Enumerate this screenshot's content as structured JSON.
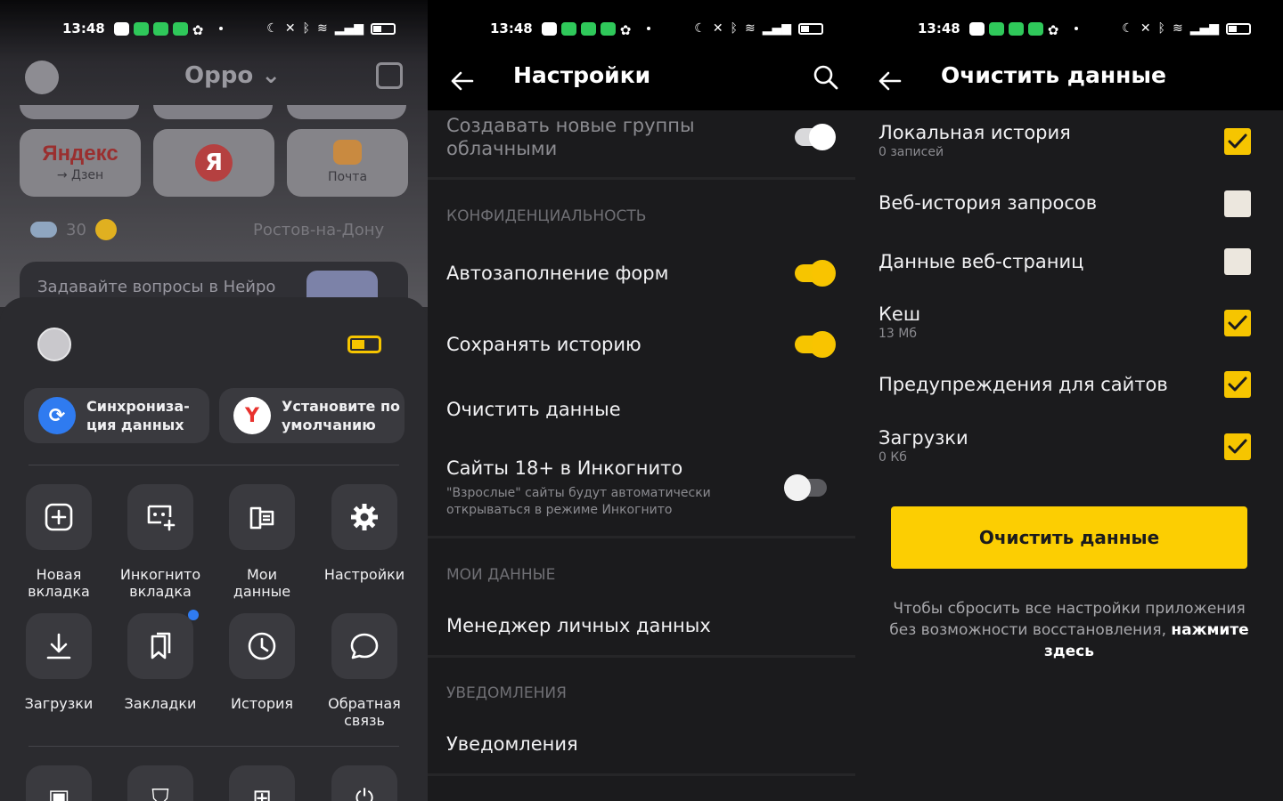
{
  "status": {
    "time": "13:48"
  },
  "panel1": {
    "header_title": "Oppo",
    "tiles": [
      {
        "title": "Яндекс",
        "subtitle": "→ Дзен"
      },
      {
        "title": "Я",
        "subtitle": ""
      },
      {
        "title": "",
        "subtitle": "Почта"
      }
    ],
    "weather": {
      "temp": "30",
      "city": "Ростов-на-Дону"
    },
    "neuro_prompt": "Задавайте вопросы в Нейро",
    "cards": [
      {
        "label": "Синхрониза-\nция данных"
      },
      {
        "label": "Установите по\nумолчанию"
      }
    ],
    "grid": [
      {
        "label": "Новая\nвкладка",
        "icon": "new-tab-icon"
      },
      {
        "label": "Инкогнито\nвкладка",
        "icon": "incognito-icon"
      },
      {
        "label": "Мои\nданные",
        "icon": "my-data-icon"
      },
      {
        "label": "Настройки",
        "icon": "gear-icon"
      },
      {
        "label": "Загрузки",
        "icon": "download-icon"
      },
      {
        "label": "Закладки",
        "icon": "bookmarks-icon"
      },
      {
        "label": "История",
        "icon": "clock-icon"
      },
      {
        "label": "Обратная\nсвязь",
        "icon": "chat-bubble-icon"
      }
    ],
    "accent": "#f6c500"
  },
  "panel2": {
    "title": "Настройки",
    "cloud_groups": "Создавать новые группы\nоблачными",
    "section_privacy": "КОНФИДЕНЦИАЛЬНОСТЬ",
    "autofill": "Автозаполнение форм",
    "save_history": "Сохранять историю",
    "clear_data": "Очистить данные",
    "incognito_18": "Сайты 18+ в Инкогнито",
    "incognito_18_desc": "\"Взрослые\" сайты будут автоматически\nоткрываться в режиме Инкогнито",
    "section_my_data": "МОИ ДАННЫЕ",
    "personal_data_manager": "Менеджер личных данных",
    "section_notifications": "УВЕДОМЛЕНИЯ",
    "notifications": "Уведомления"
  },
  "panel3": {
    "title": "Очистить данные",
    "items": [
      {
        "label": "Локальная история",
        "sub": "0 записей",
        "checked": true
      },
      {
        "label": "Веб-история запросов",
        "sub": "",
        "checked": false
      },
      {
        "label": "Данные веб-страниц",
        "sub": "",
        "checked": false
      },
      {
        "label": "Кеш",
        "sub": "13 Мб",
        "checked": true
      },
      {
        "label": "Предупреждения для сайтов",
        "sub": "",
        "checked": true
      },
      {
        "label": "Загрузки",
        "sub": "0 Кб",
        "checked": true
      }
    ],
    "button": "Очистить данные",
    "reset_text": "Чтобы сбросить все настройки приложения без возможности восстановления,",
    "reset_link": "нажмите здесь"
  }
}
